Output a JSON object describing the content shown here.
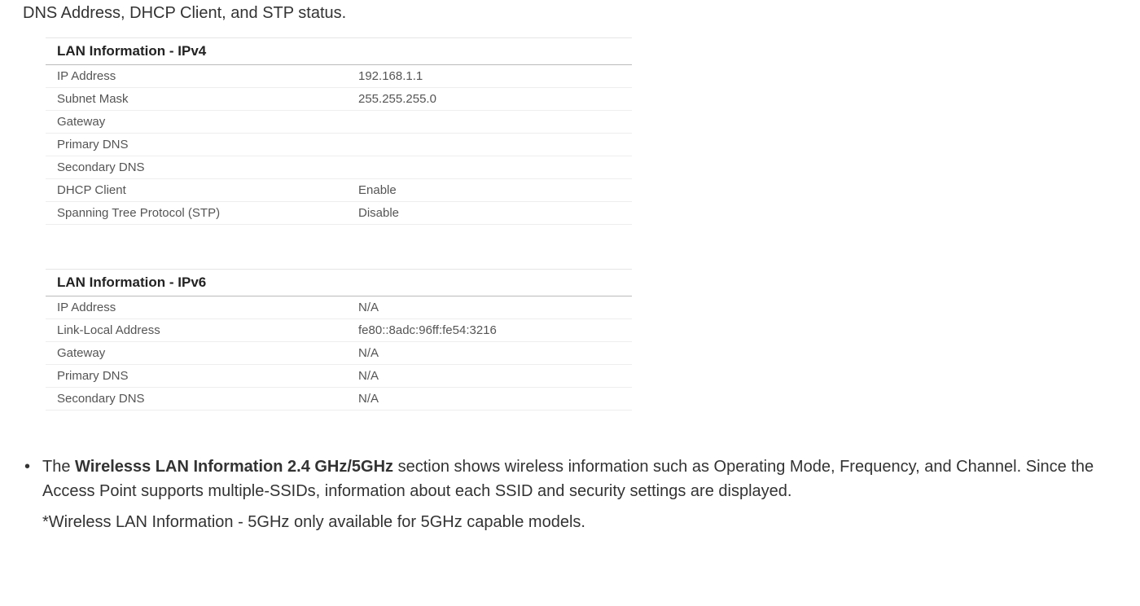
{
  "intro_text": "DNS Address, DHCP Client, and STP status.",
  "ipv4": {
    "title": "LAN Information - IPv4",
    "rows": [
      {
        "label": "IP Address",
        "value": "192.168.1.1"
      },
      {
        "label": "Subnet Mask",
        "value": "255.255.255.0"
      },
      {
        "label": "Gateway",
        "value": ""
      },
      {
        "label": "Primary DNS",
        "value": ""
      },
      {
        "label": "Secondary DNS",
        "value": ""
      },
      {
        "label": "DHCP Client",
        "value": "Enable"
      },
      {
        "label": "Spanning Tree Protocol (STP)",
        "value": "Disable"
      }
    ]
  },
  "ipv6": {
    "title": "LAN Information - IPv6",
    "rows": [
      {
        "label": "IP Address",
        "value": "N/A"
      },
      {
        "label": "Link-Local Address",
        "value": "fe80::8adc:96ff:fe54:3216"
      },
      {
        "label": "Gateway",
        "value": "N/A"
      },
      {
        "label": "Primary DNS",
        "value": "N/A"
      },
      {
        "label": "Secondary DNS",
        "value": "N/A"
      }
    ]
  },
  "bullet": {
    "prefix": "The ",
    "bold": "Wirelesss LAN Information 2.4 GHz/5GHz",
    "rest": " section shows wireless information such as Operating Mode, Frequency, and Channel. Since the Access Point supports multiple-SSIDs, information about each SSID and security settings are displayed."
  },
  "footnote": "*Wireless LAN Information - 5GHz only available for 5GHz capable models."
}
